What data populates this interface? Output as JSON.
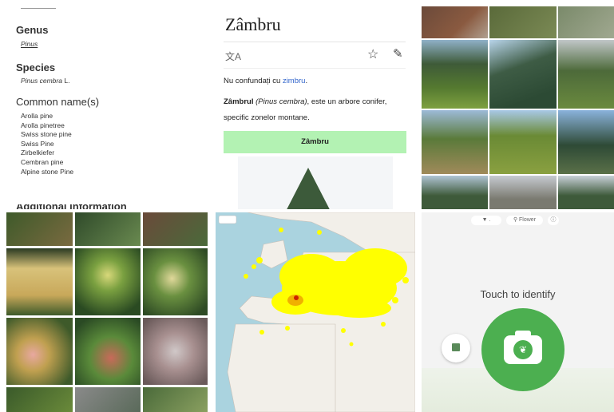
{
  "taxonomy": {
    "genus_heading": "Genus",
    "genus_value": "Pinus",
    "species_heading": "Species",
    "species_value_name": "Pinus cembra",
    "species_value_author": "L.",
    "common_heading": "Common name(s)",
    "common_names": [
      "Arolla pine",
      "Arolla pinetree",
      "Swiss stone pine",
      "Swiss Pine",
      "Zirbelkiefer",
      "Cembran pine",
      "Alpine stone Pine"
    ],
    "more_heading": "Additional information"
  },
  "wiki": {
    "title": "Zâmbru",
    "hatnote_prefix": "Nu confundați cu ",
    "hatnote_link": "zimbru",
    "hatnote_suffix": ".",
    "lead_bold": "Zâmbrul",
    "lead_italic": "(Pinus cembra)",
    "lead_rest": ", este un arbore conifer, specific zonelor montane.",
    "infobox_title": "Zâmbru",
    "language_icon": "translate-icon",
    "star_icon": "star-icon",
    "edit_icon": "pencil-icon"
  },
  "identify": {
    "prompt": "Touch to identify",
    "chip_left": "▼ .",
    "chip_mid": "⚲ Flower",
    "camera_icon": "camera-icon",
    "gallery_icon": "gallery-icon",
    "accent": "#4caf50"
  },
  "colors": {
    "accent_green": "#4caf50",
    "infobox_green": "#b3f2b3",
    "link_blue": "#3366cc",
    "map_water": "#aad3df",
    "map_land": "#f2efe9",
    "occurrence": "#ffff00"
  }
}
